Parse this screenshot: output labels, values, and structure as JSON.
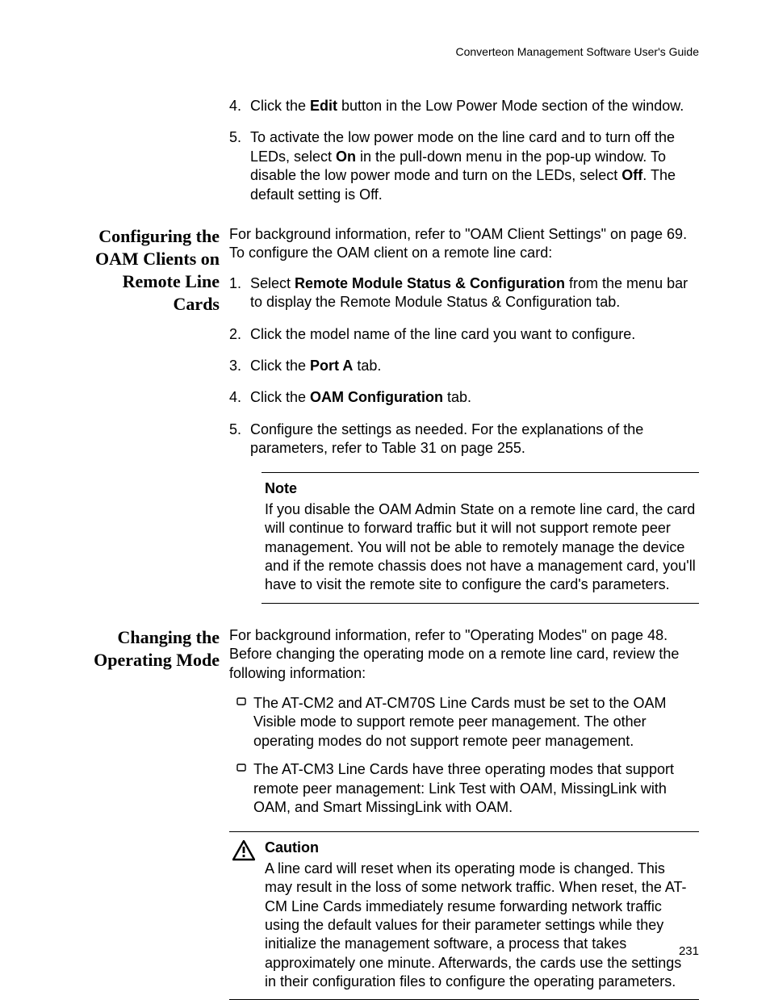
{
  "header": {
    "running": "Converteon Management Software User's Guide"
  },
  "top_steps": {
    "items": [
      {
        "num": "4.",
        "pre": "Click the ",
        "bold": "Edit",
        "post": " button in the Low Power Mode section of the window."
      },
      {
        "num": "5.",
        "pre": "To activate the low power mode on the line card and to turn off the LEDs, select ",
        "bold": "On",
        "mid": " in the pull-down menu in the pop-up window. To disable the low power mode and turn on the LEDs, select ",
        "bold2": "Off",
        "post": ". The default setting is Off."
      }
    ]
  },
  "section_oam": {
    "heading_l1": "Configuring the",
    "heading_l2": "OAM Clients on",
    "heading_l3": "Remote Line",
    "heading_l4": "Cards",
    "intro": "For background information, refer to \"OAM Client Settings\" on page 69. To configure the OAM client on a remote line card:",
    "steps": [
      {
        "num": "1.",
        "pre": "Select ",
        "bold": "Remote Module Status & Configuration",
        "post": " from the menu bar to display the Remote Module Status & Configuration tab."
      },
      {
        "num": "2.",
        "text": "Click the model name of the line card you want to configure."
      },
      {
        "num": "3.",
        "pre": "Click the ",
        "bold": "Port A",
        "post": " tab."
      },
      {
        "num": "4.",
        "pre": "Click the ",
        "bold": "OAM Configuration",
        "post": " tab."
      },
      {
        "num": "5.",
        "text": "Configure the settings as needed. For the explanations of the parameters, refer to Table 31 on page 255."
      }
    ],
    "note": {
      "title": "Note",
      "body": "If you disable the OAM Admin State on a remote line card, the card will continue to forward traffic but it will not support remote peer management. You will not be able to remotely manage the device and if the remote chassis does not have a management card, you'll have to visit the remote site to configure the card's parameters."
    }
  },
  "section_opmode": {
    "heading_l1": "Changing the",
    "heading_l2": "Operating Mode",
    "intro": "For background information, refer to \"Operating Modes\" on page 48. Before changing the operating mode on a remote line card, review the following information:",
    "bullets": [
      "The AT-CM2 and AT-CM70S Line Cards must be set to the OAM Visible mode to support remote peer management. The other operating modes do not support remote peer management.",
      "The AT-CM3 Line Cards have three operating modes that support remote peer management: Link Test with OAM, MissingLink with OAM, and Smart MissingLink with OAM."
    ],
    "caution": {
      "title": "Caution",
      "body": "A line card will reset when its operating mode is changed. This may result in the loss of some network traffic. When reset, the AT-CM Line Cards immediately resume forwarding network traffic using the default values for their parameter settings while they initialize the management software, a process that takes approximately one minute. Afterwards, the cards use the settings in their configuration files to configure the operating parameters."
    }
  },
  "page_number": "231"
}
